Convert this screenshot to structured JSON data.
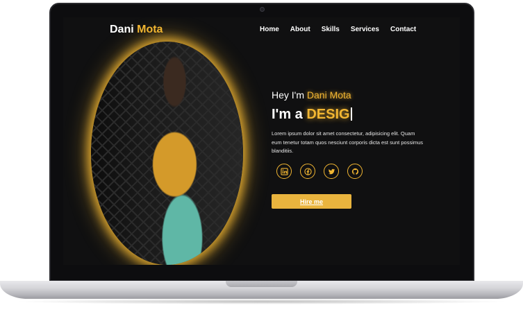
{
  "brand": {
    "name_first": "Dani",
    "name_accent": "Mota"
  },
  "nav": [
    {
      "label": "Home"
    },
    {
      "label": "About"
    },
    {
      "label": "Skills"
    },
    {
      "label": "Services"
    },
    {
      "label": "Contact"
    }
  ],
  "hero": {
    "greeting": "Hey I'm",
    "name": "Dani Mota",
    "role_prefix": "I'm a",
    "role_typed": "DESIG",
    "description": "Lorem ipsum dolor sit amet consectetur, adipisicing elit. Quam eum tenetur totam quos nesciunt corporis dicta est sunt possimus blanditiis.",
    "cta": "Hire me"
  },
  "socials": [
    {
      "icon": "linkedin-icon"
    },
    {
      "icon": "facebook-icon"
    },
    {
      "icon": "twitter-icon"
    },
    {
      "icon": "github-icon"
    }
  ],
  "colors": {
    "accent": "#f2b632",
    "background": "#101011",
    "text": "#ffffff"
  }
}
